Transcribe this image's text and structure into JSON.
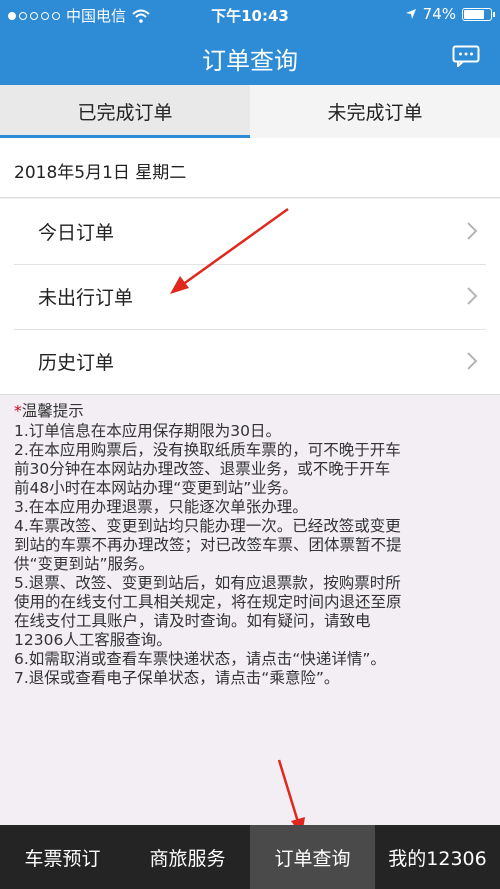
{
  "status_bar": {
    "carrier": "中国电信",
    "time": "下午10:43",
    "battery": "74%",
    "signal_icon": "signal-dots-icon",
    "wifi_icon": "wifi-icon",
    "location_icon": "location-arrow-icon"
  },
  "header": {
    "title": "订单查询",
    "chat_icon": "chat-bubble-icon"
  },
  "tabs": [
    {
      "label": "已完成订单",
      "active": true
    },
    {
      "label": "未完成订单",
      "active": false
    }
  ],
  "date": "2018年5月1日  星期二",
  "orders": [
    {
      "label": "今日订单"
    },
    {
      "label": "未出行订单"
    },
    {
      "label": "历史订单"
    }
  ],
  "tips": {
    "star": "*",
    "title": "温馨提示",
    "lines": [
      "1.订单信息在本应用保存期限为30日。",
      "2.在本应用购票后，没有换取纸质车票的，可不晚于开车",
      "前30分钟在本网站办理改签、退票业务，或不晚于开车",
      "前48小时在本网站办理“变更到站”业务。",
      "3.在本应用办理退票，只能逐次单张办理。",
      "4.车票改签、变更到站均只能办理一次。已经改签或变更",
      "到站的车票不再办理改签；对已改签车票、团体票暂不提",
      "供“变更到站”服务。",
      "5.退票、改签、变更到站后，如有应退票款，按购票时所",
      "使用的在线支付工具相关规定，将在规定时间内退还至原",
      "在线支付工具账户，请及时查询。如有疑问，请致电",
      "12306人工客服查询。",
      "6.如需取消或查看车票快递状态，请点击“快递详情”。",
      "7.退保或查看电子保单状态，请点击“乘意险”。"
    ]
  },
  "bottom_nav": [
    {
      "label": "车票预订",
      "active": false
    },
    {
      "label": "商旅服务",
      "active": false
    },
    {
      "label": "订单查询",
      "active": true
    },
    {
      "label": "我的12306",
      "active": false
    }
  ],
  "colors": {
    "brand_blue": "#2e8bd6",
    "annotation_red": "#e0281f",
    "bottom_bar": "#242424"
  }
}
